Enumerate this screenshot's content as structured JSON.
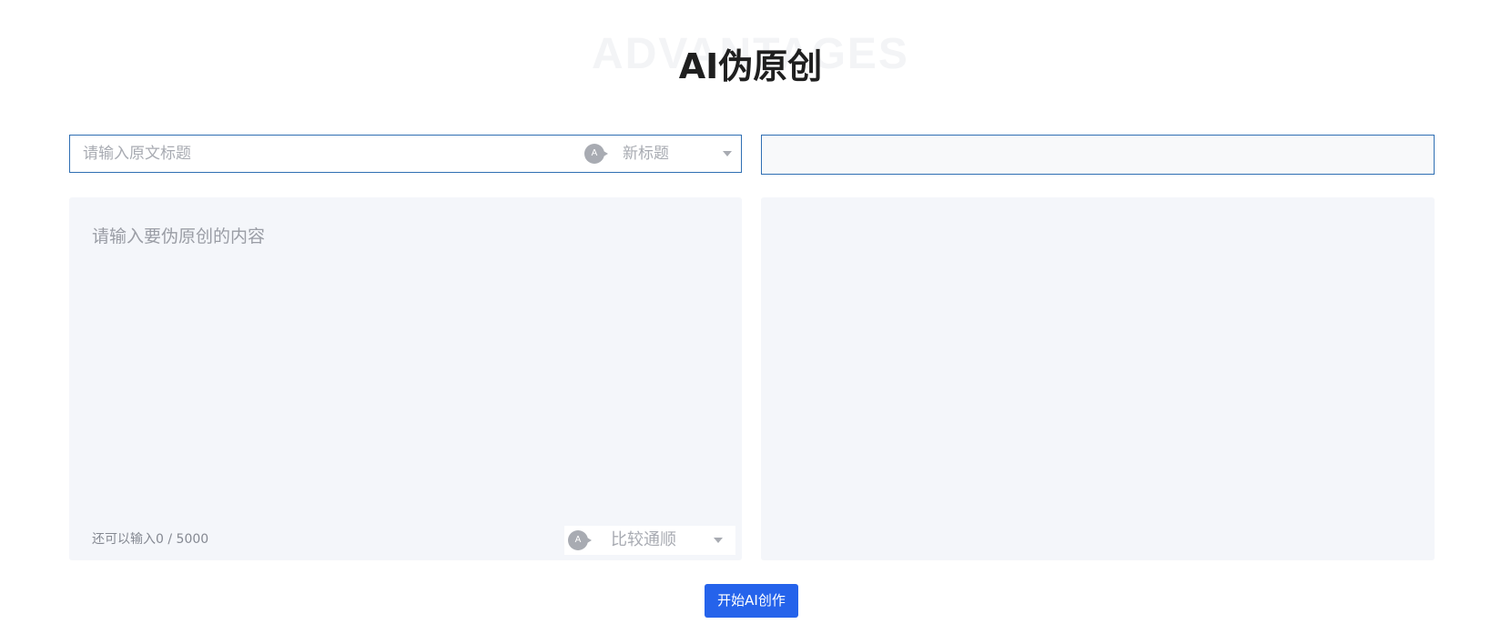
{
  "header": {
    "watermark": "ADVANTAGES",
    "title": "AI伪原创"
  },
  "title_row": {
    "input_placeholder": "请输入原文标题",
    "input_value": "",
    "ai_badge": "A",
    "mode_select_value": "新标题",
    "result_value": ""
  },
  "content": {
    "placeholder": "请输入要伪原创的内容",
    "value": "",
    "counter_prefix": "还可以输入",
    "counter_current": "0",
    "counter_separator": " / ",
    "counter_max": "5000",
    "ai_badge": "A",
    "style_select_value": "比较通顺"
  },
  "result": {
    "content": ""
  },
  "actions": {
    "start_label": "开始AI创作",
    "primary_color": "#2563eb"
  }
}
